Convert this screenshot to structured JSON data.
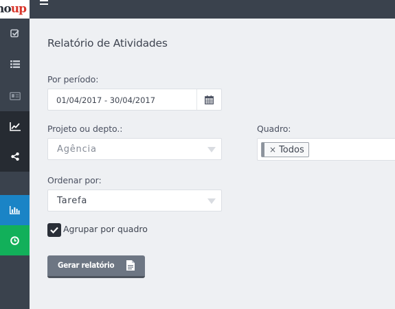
{
  "app": {
    "logo_dark": "no",
    "logo_accent": "up"
  },
  "sidebar": {
    "items": [
      {
        "icon": "check-square-icon",
        "active": false
      },
      {
        "icon": "list-icon",
        "active": false
      },
      {
        "icon": "id-card-icon",
        "active": false
      },
      {
        "icon": "line-chart-icon",
        "active": true
      },
      {
        "icon": "share-icon",
        "active": true
      },
      {
        "icon": "bar-chart-icon",
        "color": "#1a84c6"
      },
      {
        "icon": "clock-icon",
        "color": "#12b05a"
      }
    ]
  },
  "page": {
    "title": "Relatório de Atividades"
  },
  "form": {
    "periodo_label": "Por período:",
    "periodo_value": "01/04/2017 - 30/04/2017",
    "projeto_label": "Projeto ou depto.:",
    "projeto_value": "Agência",
    "quadro_label": "Quadro:",
    "quadro_tag_remove": "×",
    "quadro_tag": "Todos",
    "ordenar_label": "Ordenar por:",
    "ordenar_value": "Tarefa",
    "agrupar_label": "Agrupar por quadro",
    "agrupar_checked": true,
    "submit_label": "Gerar relatório"
  },
  "colors": {
    "sidebar_bg": "#3a424d",
    "sidebar_active_bg": "#262b32",
    "accent_blue": "#1a84c6",
    "accent_green": "#12b05a",
    "button_bg": "#6d7683"
  }
}
